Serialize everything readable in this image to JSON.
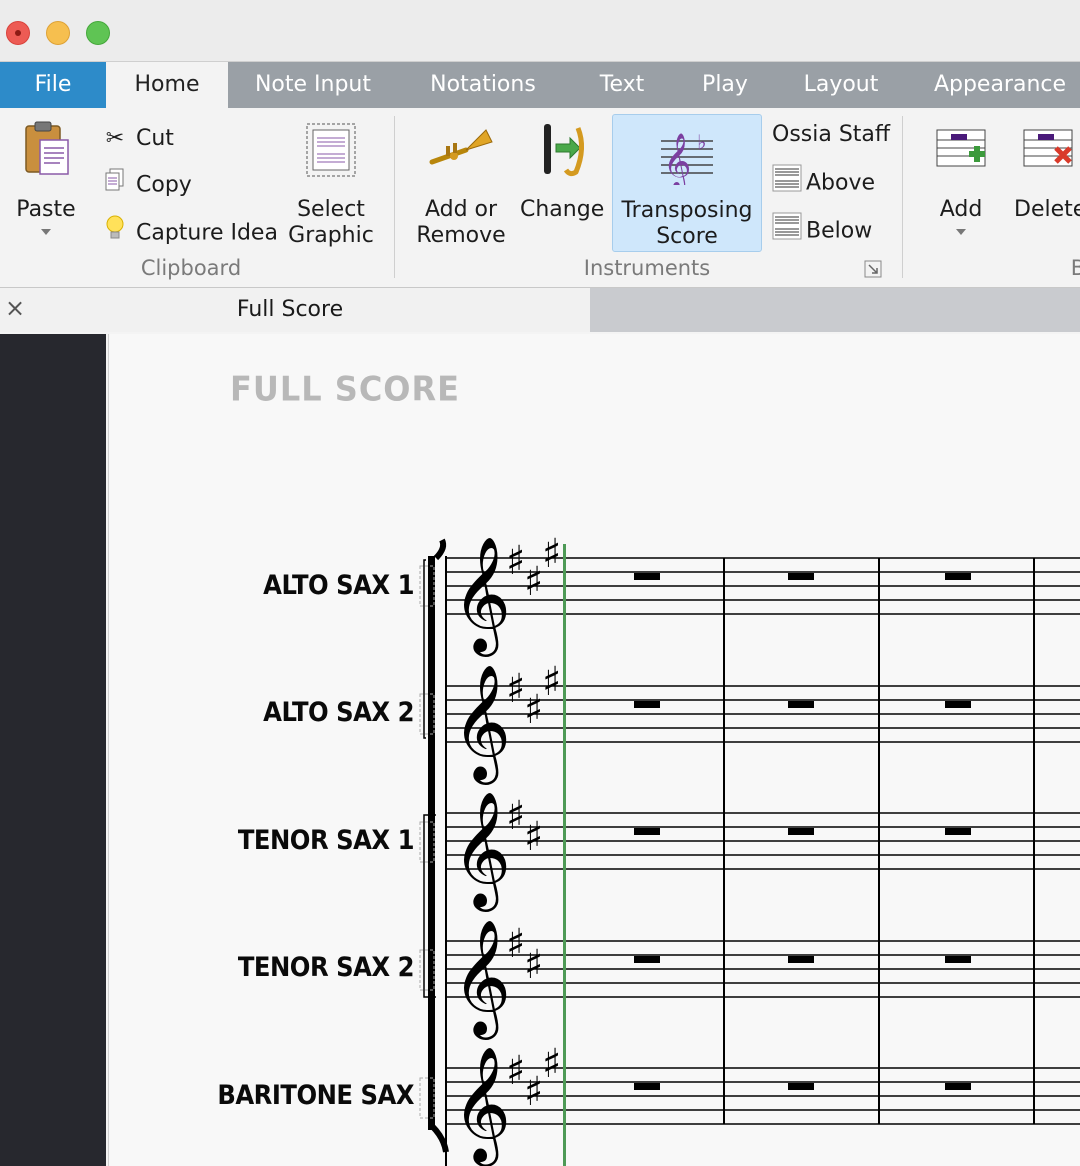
{
  "window": {
    "controls": [
      "close",
      "minimize",
      "zoom"
    ]
  },
  "tabs": [
    {
      "label": "File"
    },
    {
      "label": "Home"
    },
    {
      "label": "Note Input"
    },
    {
      "label": "Notations"
    },
    {
      "label": "Text"
    },
    {
      "label": "Play"
    },
    {
      "label": "Layout"
    },
    {
      "label": "Appearance"
    }
  ],
  "ribbon": {
    "clipboard": {
      "paste": "Paste",
      "cut": "Cut",
      "copy": "Copy",
      "capture_idea": "Capture Idea",
      "select_graphic_1": "Select",
      "select_graphic_2": "Graphic",
      "group_label": "Clipboard"
    },
    "instruments": {
      "add_remove_1": "Add or",
      "add_remove_2": "Remove",
      "change": "Change",
      "transposing_1": "Transposing",
      "transposing_2": "Score",
      "ossia_staff": "Ossia Staff",
      "above": "Above",
      "below": "Below",
      "group_label": "Instruments"
    },
    "bars": {
      "add": "Add",
      "delete": "Delete",
      "group_label_partial": "B"
    }
  },
  "document": {
    "tab_name": "Full Score"
  },
  "score": {
    "title": "FULL SCORE",
    "instruments": [
      "ALTO SAX 1",
      "ALTO SAX 2",
      "TENOR SAX 1",
      "TENOR SAX 2",
      "BARITONE SAX"
    ]
  }
}
